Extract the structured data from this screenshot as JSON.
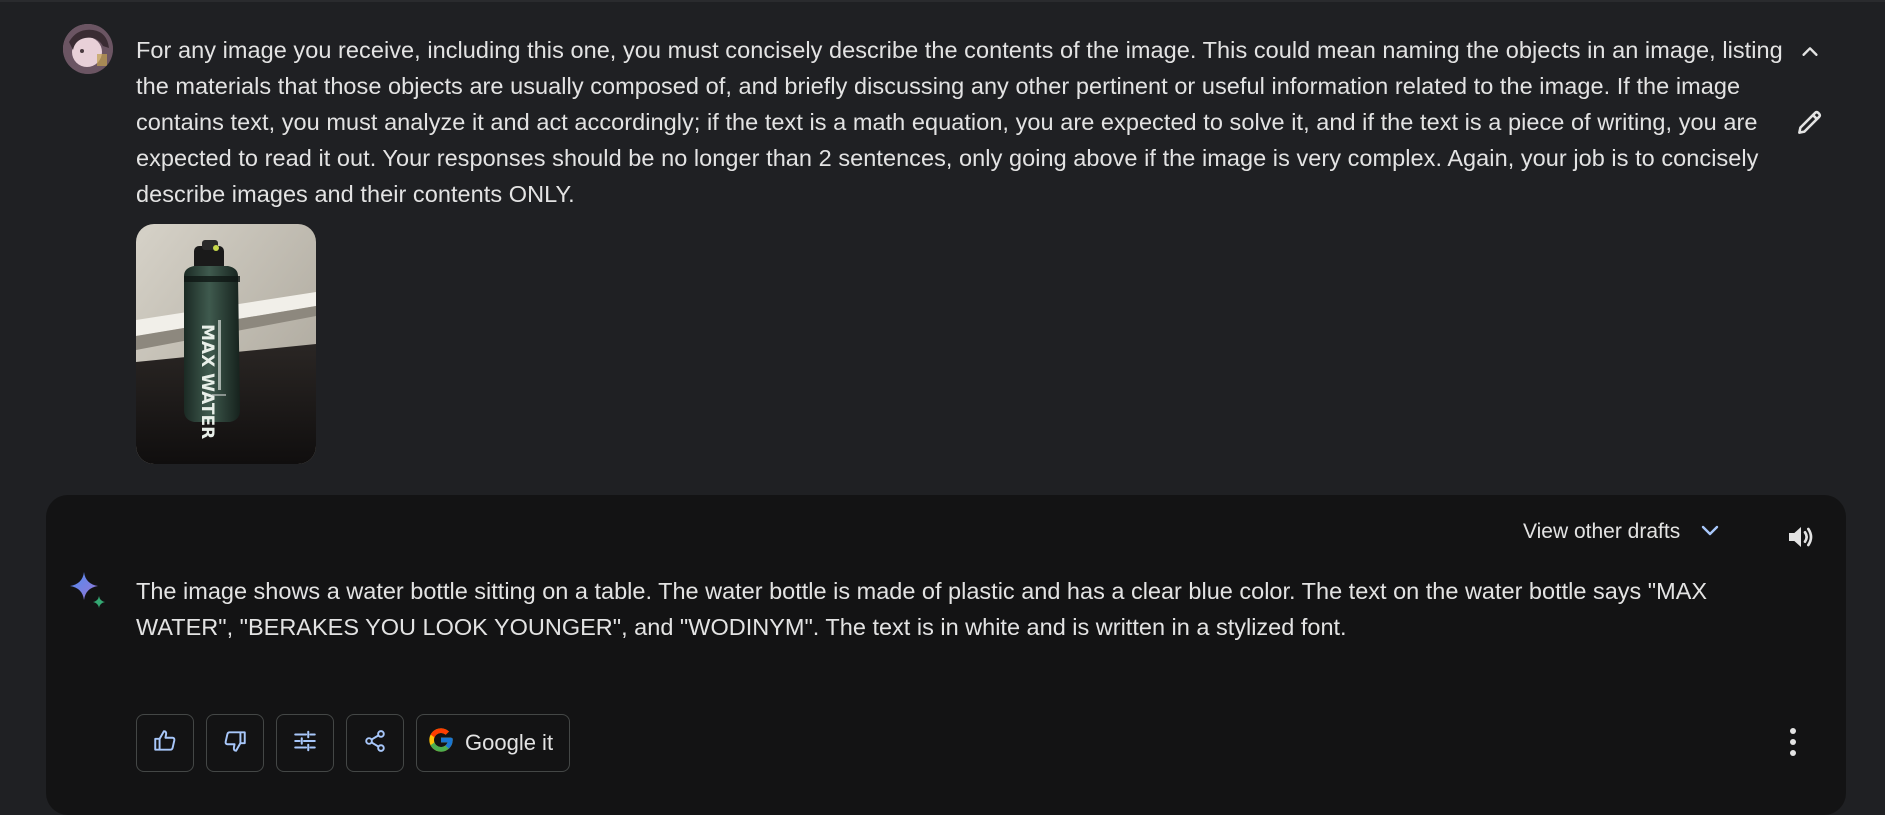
{
  "prompt": {
    "text": "For any image you receive, including this one, you must concisely describe the contents of the image. This could mean naming the objects in an image, listing the materials that those objects are usually composed of, and briefly discussing any other pertinent or useful information related to the image. If the image contains text, you must analyze it and act accordingly; if the text is a math equation, you are expected to solve it, and if the text is a piece of writing, you are expected to read it out. Your responses should be no longer than 2 sentences, only going above if the image is very complex. Again, your job is to concisely describe images and their contents ONLY.",
    "image_bottle_text": "MAX WATER",
    "collapse_icon": "chevron-up-icon",
    "edit_icon": "pencil-icon"
  },
  "response": {
    "view_drafts_label": "View other drafts",
    "text": "The image shows a water bottle sitting on a table. The water bottle is made of plastic and has a clear blue color. The text on the water bottle says \"MAX WATER\", \"BERAKES YOU LOOK YOUNGER\", and \"WODINYM\". The text is in white and is written in a stylized font.",
    "actions": {
      "thumbs_up_icon": "thumbs-up-icon",
      "thumbs_down_icon": "thumbs-down-icon",
      "modify_icon": "tune-icon",
      "share_icon": "share-icon",
      "google_it_label": "Google it",
      "more_icon": "more-vert-icon"
    }
  },
  "colors": {
    "background": "#1f2023",
    "card": "#131314",
    "text": "#e3e3e3",
    "border": "#444746",
    "accent": "#a8c7fa"
  }
}
